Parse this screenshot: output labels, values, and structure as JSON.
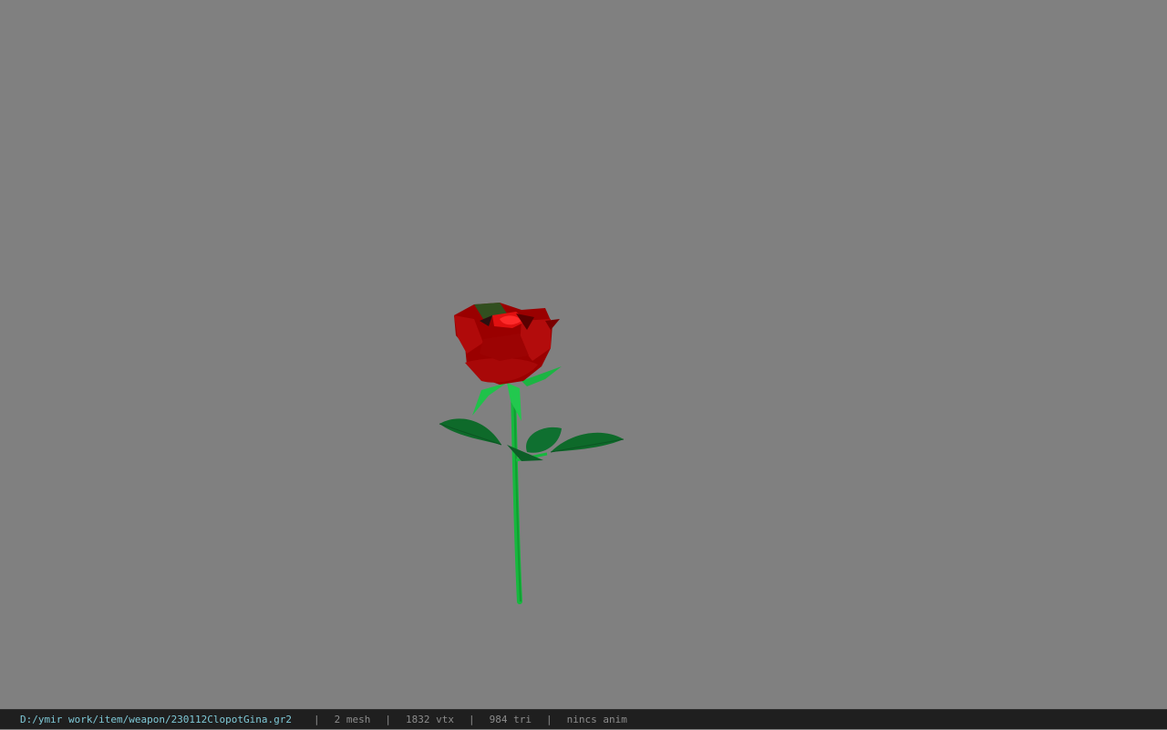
{
  "viewer": {
    "background_color": "#808080",
    "model_name": "rose"
  },
  "status": {
    "file_path": "D:/ymir work/item/weapon/230112ClopotGina.gr2",
    "separator": "|",
    "mesh": "2 mesh",
    "vertices": "1832 vtx",
    "triangles": "984 tri",
    "animation": "nincs anim"
  },
  "colors": {
    "petal_dark": "#8a0000",
    "petal_mid": "#b00000",
    "petal_bright": "#e01010",
    "stem": "#16b83e",
    "leaf": "#0e6a2a",
    "path_text": "#7ec8d6",
    "status_text": "#8c8c8c"
  }
}
